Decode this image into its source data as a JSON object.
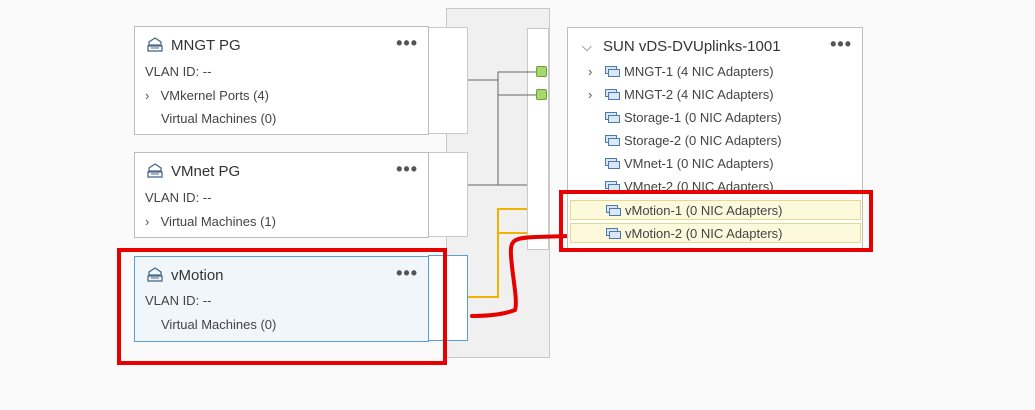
{
  "port_groups": [
    {
      "title": "MNGT PG",
      "vlan": "VLAN ID: --",
      "rows": [
        {
          "label": "VMkernel Ports (4)",
          "expandable": true
        },
        {
          "label": "Virtual Machines (0)",
          "expandable": false
        }
      ]
    },
    {
      "title": "VMnet PG",
      "vlan": "VLAN ID: --",
      "rows": [
        {
          "label": "Virtual Machines (1)",
          "expandable": true
        }
      ]
    },
    {
      "title": "vMotion",
      "vlan": "VLAN ID: --",
      "rows": [
        {
          "label": "Virtual Machines (0)",
          "expandable": false
        }
      ],
      "selected": true
    }
  ],
  "card_menu_glyph": "•••",
  "uplinks": {
    "title": "SUN vDS-DVUplinks-1001",
    "items": [
      {
        "label": "MNGT-1 (4 NIC Adapters)",
        "expandable": true
      },
      {
        "label": "MNGT-2 (4 NIC Adapters)",
        "expandable": true
      },
      {
        "label": "Storage-1 (0 NIC Adapters)",
        "expandable": false
      },
      {
        "label": "Storage-2 (0 NIC Adapters)",
        "expandable": false
      },
      {
        "label": "VMnet-1 (0 NIC Adapters)",
        "expandable": false
      },
      {
        "label": "VMnet-2 (0 NIC Adapters)",
        "expandable": false
      },
      {
        "label": "vMotion-1 (0 NIC Adapters)",
        "expandable": false,
        "highlighted": true
      },
      {
        "label": "vMotion-2 (0 NIC Adapters)",
        "expandable": false,
        "highlighted": true
      }
    ]
  },
  "colors": {
    "annotation_red": "#e60000",
    "active_link": "#f0b400",
    "idle_link": "#666666",
    "port_green": "#a6d86e",
    "selected_border": "#5a9fd4"
  }
}
